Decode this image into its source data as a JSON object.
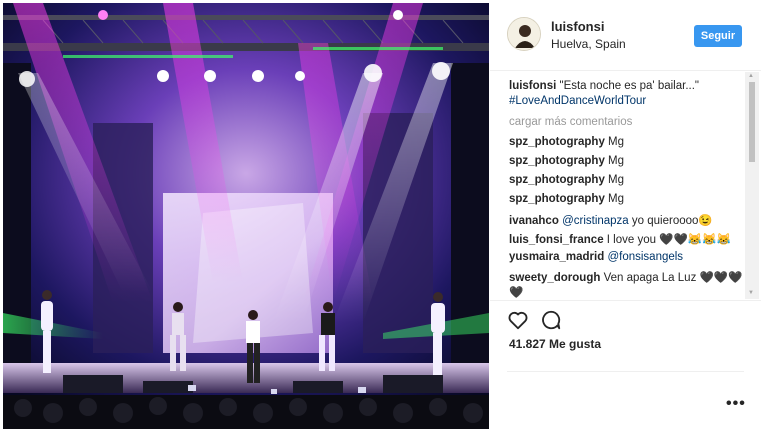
{
  "post": {
    "username": "luisfonsi",
    "location": "Huelva, Spain",
    "follow_label": "Seguir",
    "caption_user": "luisfonsi",
    "caption_text": "\"Esta noche es pa' bailar...\"",
    "caption_hashtag": "#LoveAndDanceWorldTour",
    "load_more": "cargar más comentarios",
    "likes": "41.827 Me gusta"
  },
  "comments": [
    {
      "user": "spz_photography",
      "text": "Mg"
    },
    {
      "user": "spz_photography",
      "text": "Mg"
    },
    {
      "user": "spz_photography",
      "text": "Mg"
    },
    {
      "user": "spz_photography",
      "text": "Mg"
    },
    {
      "user": "ivanahco",
      "mention": "@cristinapza",
      "text": "yo quieroooo😉"
    },
    {
      "user": "luis_fonsi_france",
      "text": "I love you 🖤🖤😹😹😹"
    },
    {
      "user": "yusmaira_madrid",
      "mention": "@fonsisangels",
      "text": ""
    },
    {
      "user": "sweety_dorough",
      "text": "Ven apaga La Luz 🖤🖤🖤"
    },
    {
      "user": "",
      "text": "🖤"
    }
  ],
  "icons": {
    "like": "heart-icon",
    "comment": "comment-bubble-icon",
    "more": "more-options-icon",
    "avatar": "avatar"
  },
  "colors": {
    "follow": "#3897f0",
    "hashtag": "#003569",
    "text": "#262626",
    "muted": "#999999"
  }
}
